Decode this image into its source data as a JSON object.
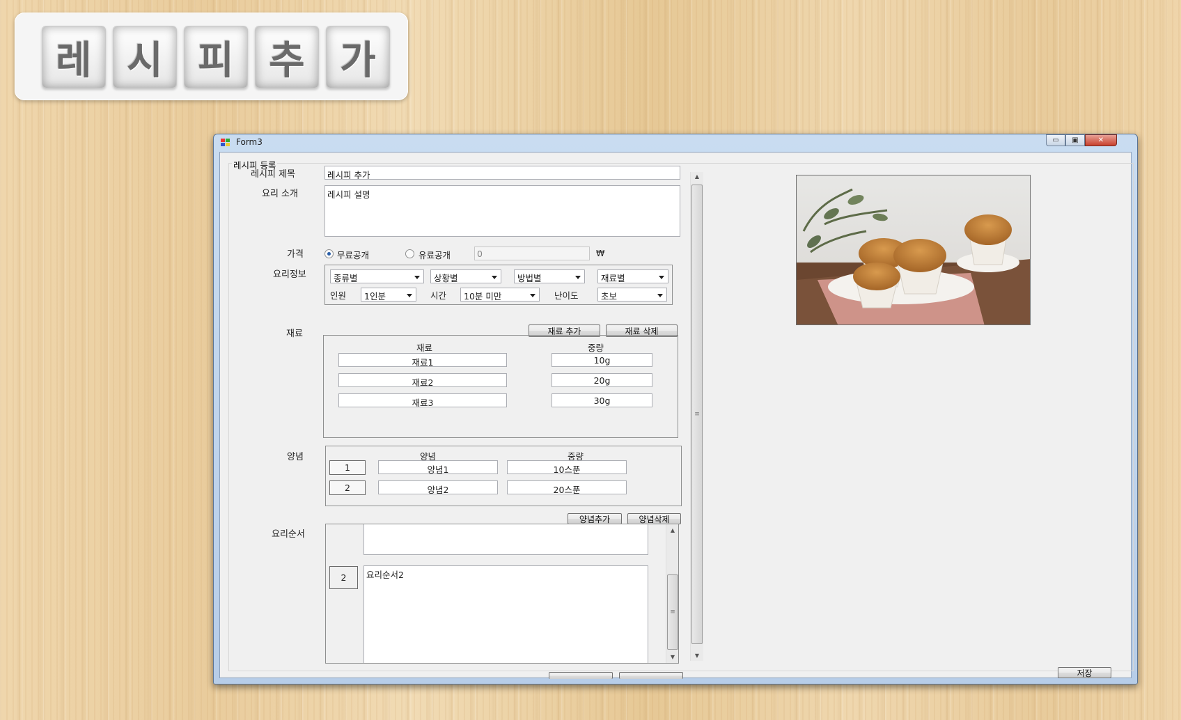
{
  "title_tiles": [
    "레",
    "시",
    "피",
    "추",
    "가"
  ],
  "window": {
    "title": "Form3",
    "min_glyph": "▭",
    "max_glyph": "▣",
    "close_glyph": "✕"
  },
  "form": {
    "group_title": "레시피 등록",
    "recipe_title_label": "레시피 제목",
    "recipe_title_value": "레시피 추가",
    "intro_label": "요리 소개",
    "intro_value": "레시피 설명",
    "price_label": "가격",
    "price_free_label": "무료공개",
    "price_paid_label": "유료공개",
    "price_value": "0",
    "currency": "₩",
    "price_selected": "free",
    "info_label": "요리정보",
    "combos": {
      "kind": "종류별",
      "situation": "상황별",
      "method": "방법별",
      "ingredient": "재료별",
      "servings_label": "인원",
      "servings": "1인분",
      "time_label": "시간",
      "time": "10분 미만",
      "difficulty_label": "난이도",
      "difficulty": "초보"
    },
    "ingredients": {
      "label": "재료",
      "add_button": "재료 추가",
      "delete_button": "재료 삭제",
      "header_name": "재료",
      "header_amount": "중량",
      "rows": [
        {
          "name": "재료1",
          "amount": "10g"
        },
        {
          "name": "재료2",
          "amount": "20g"
        },
        {
          "name": "재료3",
          "amount": "30g"
        }
      ]
    },
    "seasonings": {
      "label": "양념",
      "header_name": "양념",
      "header_amount": "중량",
      "add_button": "양념추가",
      "delete_button": "양념삭제",
      "rows": [
        {
          "no": "1",
          "name": "양념1",
          "amount": "10스푼"
        },
        {
          "no": "2",
          "name": "양념2",
          "amount": "20스푼"
        }
      ]
    },
    "steps": {
      "label": "요리순서",
      "rows": [
        {
          "no": "",
          "text": ""
        },
        {
          "no": "2",
          "text": "요리순서2"
        }
      ]
    },
    "save_button": "저장"
  }
}
